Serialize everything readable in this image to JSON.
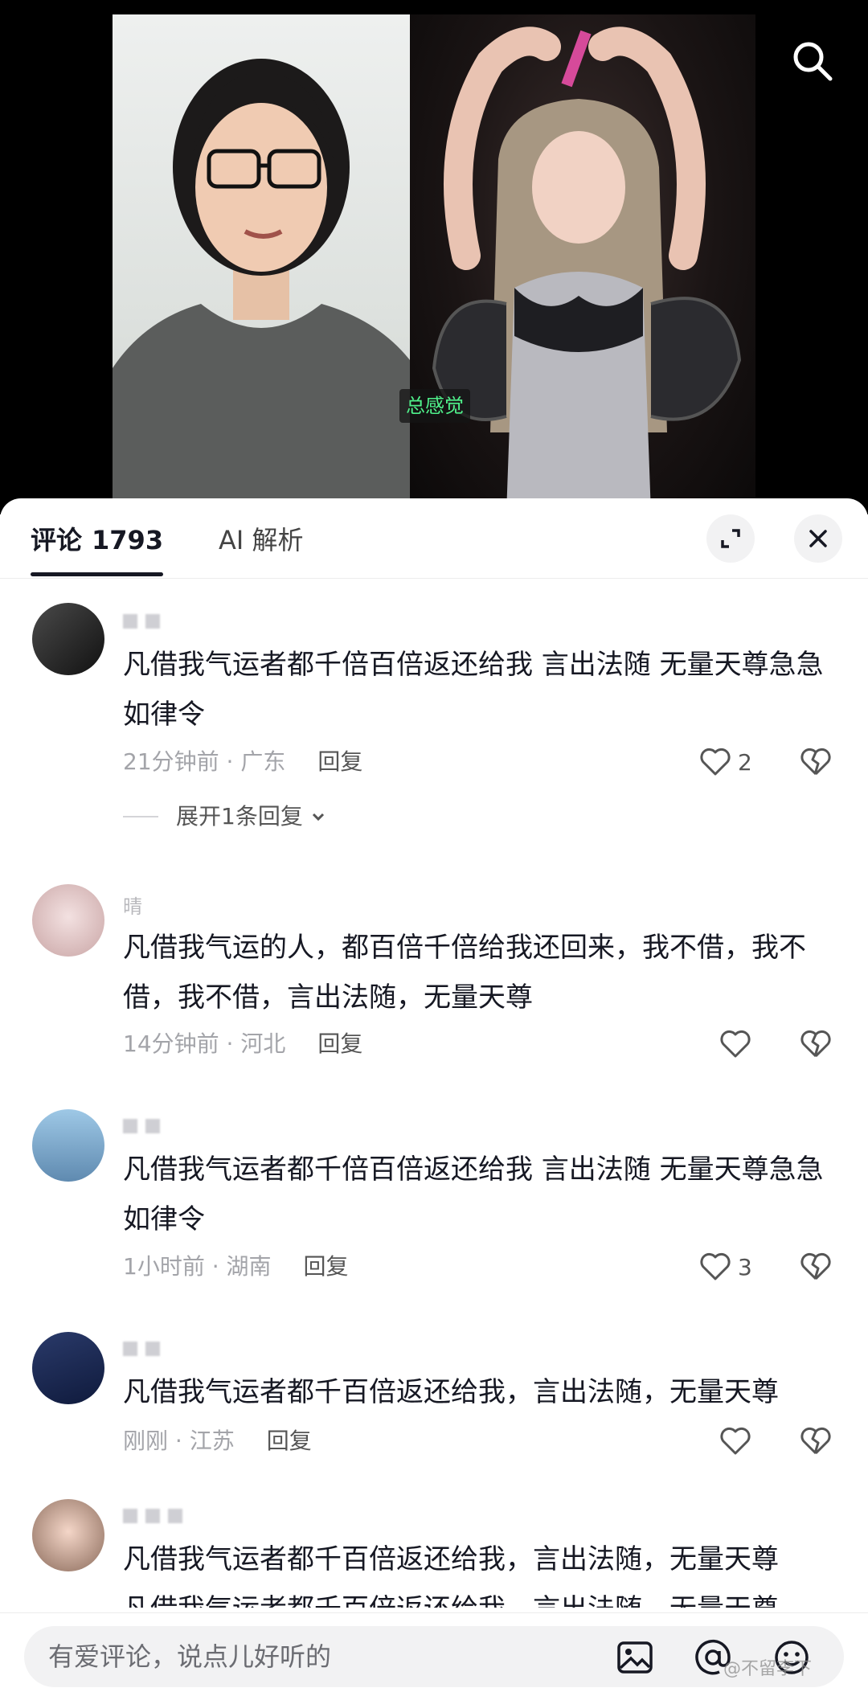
{
  "video": {
    "subtitle": "总感觉"
  },
  "tabs": {
    "comments_label": "评论",
    "comments_count": "1793",
    "ai_label": "AI 解析"
  },
  "comments": [
    {
      "text": "凡借我气运者都千倍百倍返还给我 言出法随 无量天尊急急如律令",
      "time_location": "21分钟前 · 广东",
      "reply": "回复",
      "likes": "2",
      "expand_label": "展开1条回复"
    },
    {
      "username": "晴",
      "text": "凡借我气运的人，都百倍千倍给我还回来，我不借，我不借，我不借，言出法随，无量天尊",
      "time_location": "14分钟前 · 河北",
      "reply": "回复",
      "likes": ""
    },
    {
      "text": "凡借我气运者都千倍百倍返还给我 言出法随 无量天尊急急如律令",
      "time_location": "1小时前 · 湖南",
      "reply": "回复",
      "likes": "3"
    },
    {
      "text": "凡借我气运者都千百倍返还给我，言出法随，无量天尊",
      "time_location": "刚刚 · 江苏",
      "reply": "回复",
      "likes": ""
    },
    {
      "text": "凡借我气运者都千百倍返还给我，言出法随，无量天尊",
      "text_line2": "凡借我气运者都千百倍返还给我，言出法随，无量天尊"
    }
  ],
  "input": {
    "placeholder": "有爱评论，说点儿好听的"
  },
  "watermark": "@不留李下",
  "icons": [
    "search-icon",
    "expand-icon",
    "close-icon",
    "heart-icon",
    "broken-heart-icon",
    "chevron-down-icon",
    "image-icon",
    "at-icon",
    "emoji-icon"
  ],
  "colors": {
    "subtitle_green": "#4ff08a",
    "text": "#161823",
    "meta": "#a3a4a9"
  }
}
